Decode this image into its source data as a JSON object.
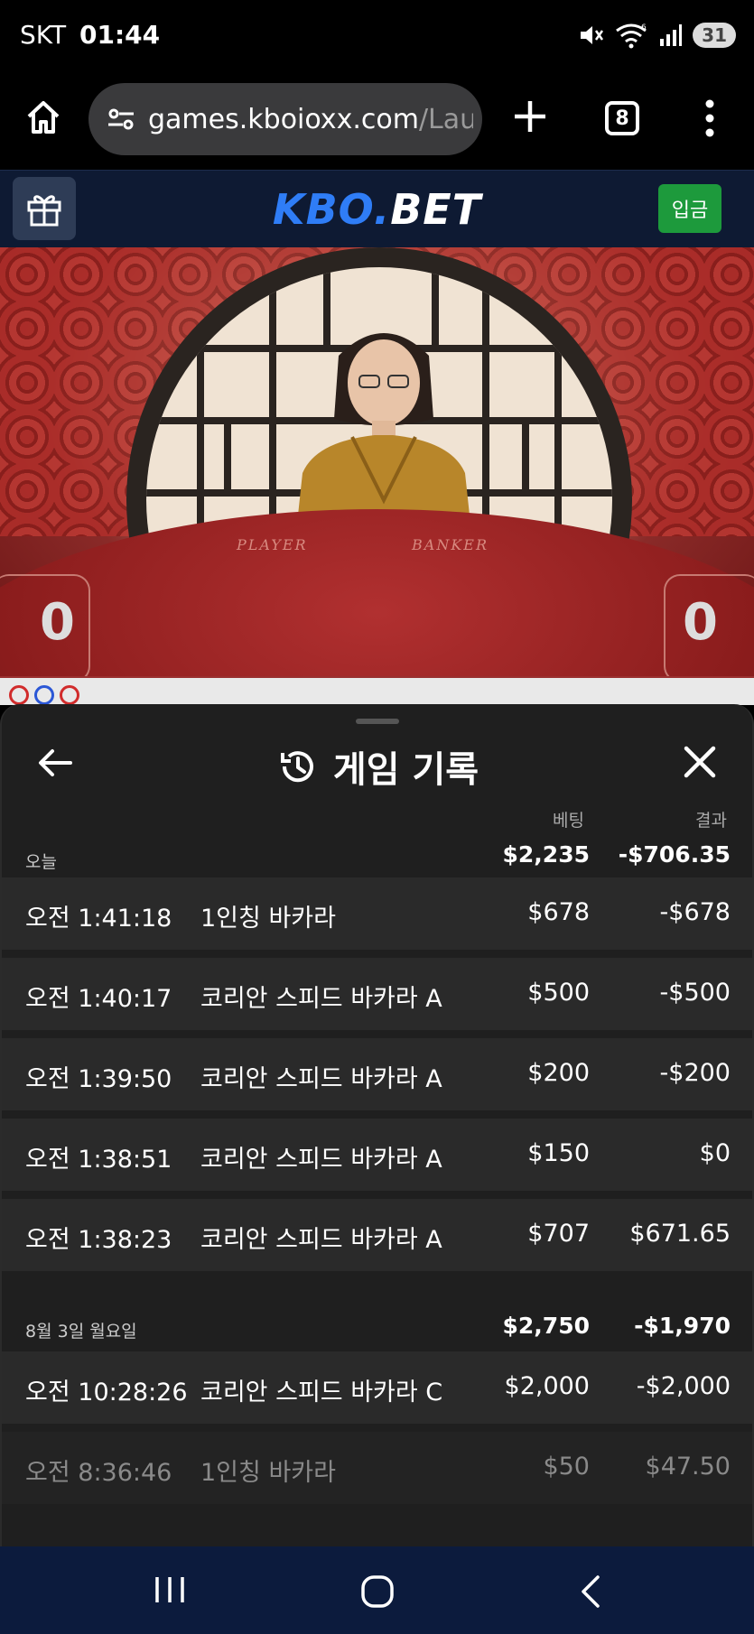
{
  "status_bar": {
    "carrier": "SKT",
    "time": "01:44",
    "battery": "31",
    "wifi_badge": "6"
  },
  "browser": {
    "url_main": "games.kboioxx.com",
    "url_rest": "/Launc",
    "tab_count": "8"
  },
  "site": {
    "logo_kbo": "KBO.",
    "logo_bet": "BET",
    "deposit_label": "입금"
  },
  "video": {
    "player_label": "PLAYER",
    "banker_label": "BANKER",
    "player_score": "0",
    "banker_score": "0"
  },
  "history": {
    "title": "게임 기록",
    "col_bet": "베팅",
    "col_result": "결과",
    "groups": [
      {
        "date": "오늘",
        "total_bet": "$2,235",
        "total_result": "-$706.35",
        "rows": [
          {
            "time": "오전 1:41:18",
            "game": "1인칭 바카라",
            "bet": "$678",
            "result": "-$678"
          },
          {
            "time": "오전 1:40:17",
            "game": "코리안 스피드 바카라 A",
            "bet": "$500",
            "result": "-$500"
          },
          {
            "time": "오전 1:39:50",
            "game": "코리안 스피드 바카라 A",
            "bet": "$200",
            "result": "-$200"
          },
          {
            "time": "오전 1:38:51",
            "game": "코리안 스피드 바카라 A",
            "bet": "$150",
            "result": "$0"
          },
          {
            "time": "오전 1:38:23",
            "game": "코리안 스피드 바카라 A",
            "bet": "$707",
            "result": "$671.65"
          }
        ]
      },
      {
        "date": "8월 3일 월요일",
        "total_bet": "$2,750",
        "total_result": "-$1,970",
        "rows": [
          {
            "time": "오전 10:28:26",
            "game": "코리안 스피드 바카라 C",
            "bet": "$2,000",
            "result": "-$2,000"
          },
          {
            "time": "오전 8:36:46",
            "game": "1인칭 바카라",
            "bet": "$50",
            "result": "$47.50"
          }
        ]
      }
    ]
  },
  "colors": {
    "site_header": "#0e1a33",
    "logo_blue": "#2f7df6",
    "deposit_green": "#1d9a3c",
    "sheet_bg": "#1f1f1f",
    "row_bg": "#2a2a2a",
    "nav_bg": "#0c1b3d"
  }
}
